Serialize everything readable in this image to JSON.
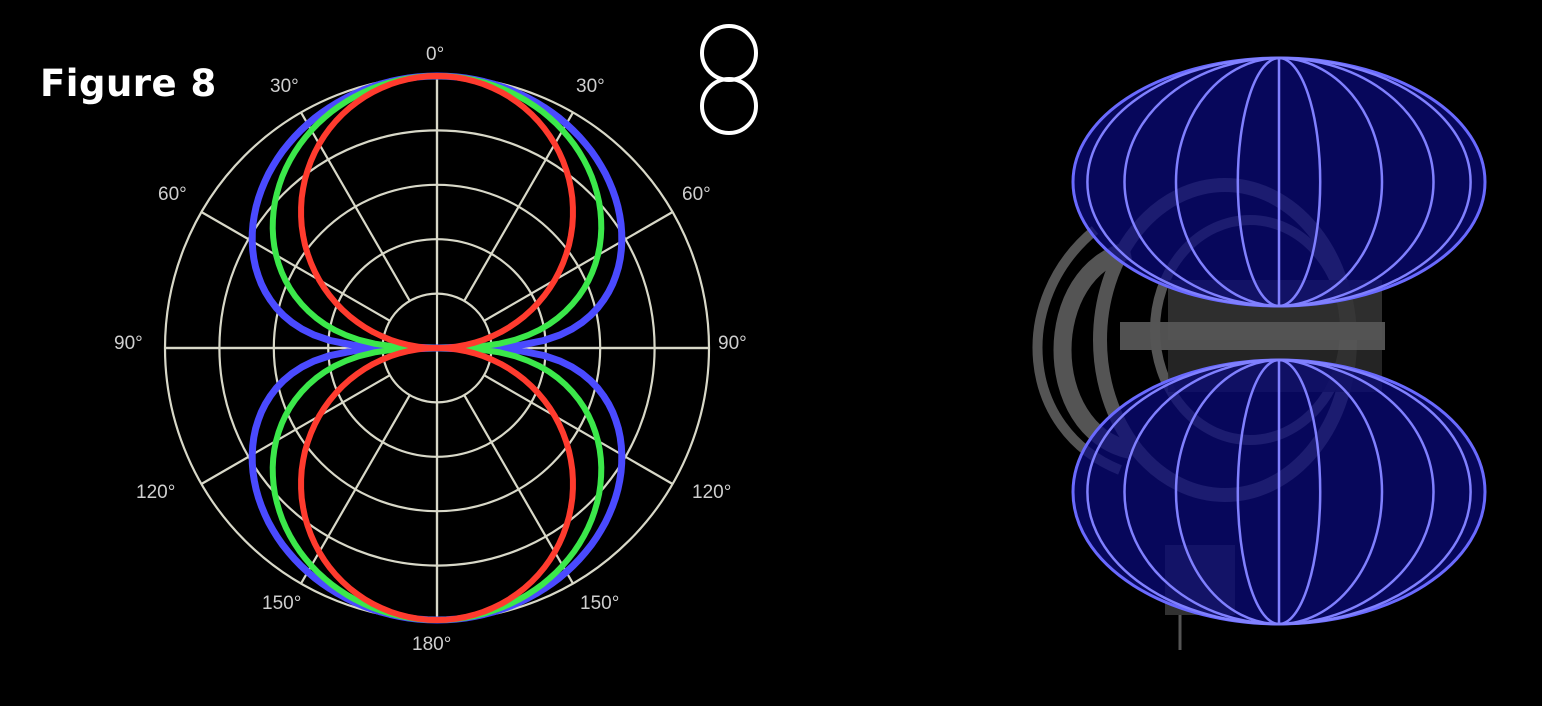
{
  "title": "Figure 8",
  "pattern_icon": "figure-eight-icon",
  "angle_labels": [
    "0°",
    "30°",
    "30°",
    "60°",
    "60°",
    "90°",
    "90°",
    "120°",
    "120°",
    "150°",
    "150°",
    "180°"
  ],
  "colors": {
    "grid": "#d8d8c8",
    "curve_red": "#ff3b2e",
    "curve_green": "#3be84a",
    "curve_blue": "#4a4aff",
    "background": "#000000"
  },
  "chart_data": {
    "type": "polar",
    "rings": 5,
    "spokes_every_deg": 30,
    "series": [
      {
        "color": "red",
        "pattern": "figure-eight, narrowest"
      },
      {
        "color": "green",
        "pattern": "figure-eight, medium"
      },
      {
        "color": "blue",
        "pattern": "figure-eight, widest"
      }
    ]
  },
  "mesh_3d": {
    "icon": "microphone-with-figure-eight-mesh-icon"
  }
}
